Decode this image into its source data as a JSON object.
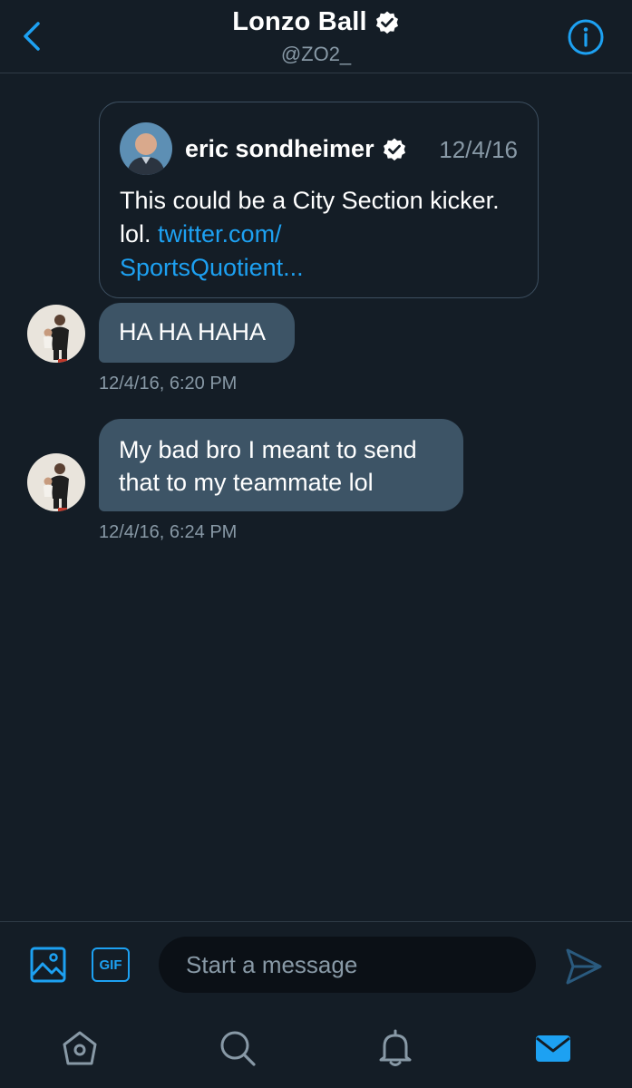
{
  "header": {
    "title": "Lonzo Ball",
    "handle": "@ZO2_",
    "back_icon": "chevron-left-icon",
    "info_icon": "info-icon"
  },
  "quoted_tweet": {
    "author": "eric sondheimer",
    "date": "12/4/16",
    "text": "This could be a City Section kicker. lol. ",
    "link_line1": "twitter.com/",
    "link_line2": "SportsQuotient..."
  },
  "messages": [
    {
      "text": "HA HA HAHA",
      "timestamp": "12/4/16, 6:20 PM"
    },
    {
      "text": "My bad bro I meant to send that to my teammate lol",
      "timestamp": "12/4/16, 6:24 PM"
    }
  ],
  "composer": {
    "placeholder": "Start a message",
    "gif_label": "GIF"
  },
  "tabs": [
    "home-icon",
    "search-icon",
    "notifications-icon",
    "messages-icon"
  ],
  "colors": {
    "background": "#141d26",
    "accent": "#1da1f2",
    "bubble": "#3d5466",
    "muted": "#8899a6"
  }
}
